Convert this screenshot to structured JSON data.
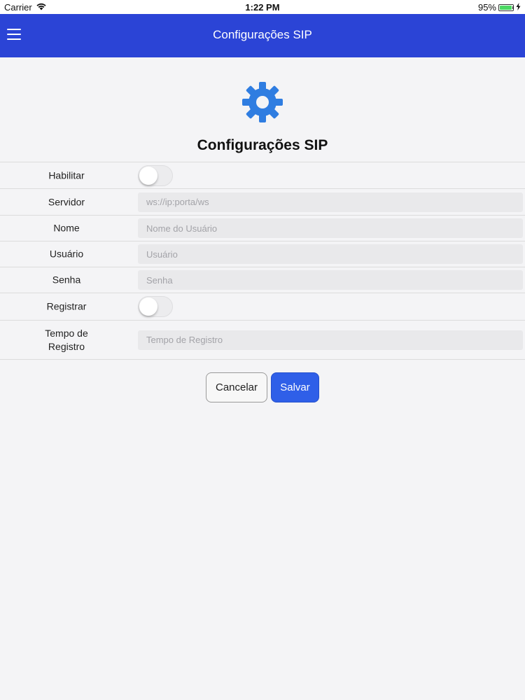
{
  "status_bar": {
    "carrier": "Carrier",
    "time": "1:22 PM",
    "battery_percent": "95%",
    "battery_level": 0.95,
    "icons": [
      "wifi-icon",
      "battery-icon",
      "charging-icon"
    ]
  },
  "nav": {
    "title": "Configurações SIP",
    "menu_icon": "hamburger-menu-icon",
    "bar_color": "#2b44d6"
  },
  "header": {
    "icon": "gear-icon",
    "icon_color": "#2f7de1",
    "title": "Configurações SIP"
  },
  "form": {
    "enable_label": "Habilitar",
    "enable_value": false,
    "server_label": "Servidor",
    "server_placeholder": "ws://ip:porta/ws",
    "server_value": "",
    "name_label": "Nome",
    "name_placeholder": "Nome do Usuário",
    "name_value": "",
    "user_label": "Usuário",
    "user_placeholder": "Usuário",
    "user_value": "",
    "password_label": "Senha",
    "password_placeholder": "Senha",
    "password_value": "",
    "register_label": "Registrar",
    "register_value": false,
    "register_time_label_line1": "Tempo de",
    "register_time_label_line2": "Registro",
    "register_time_placeholder": "Tempo de Registro",
    "register_time_value": ""
  },
  "actions": {
    "cancel_label": "Cancelar",
    "save_label": "Salvar",
    "save_color": "#2f5fe8"
  }
}
